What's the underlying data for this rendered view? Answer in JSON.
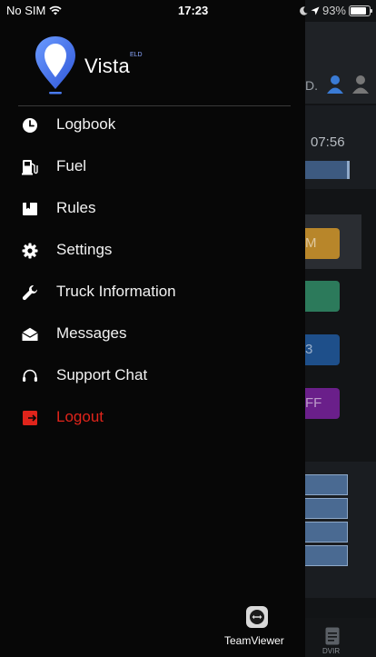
{
  "status_bar": {
    "carrier": "No SIM",
    "time": "17:23",
    "battery": "93%",
    "battery_level": 0.93
  },
  "drawer": {
    "brand": {
      "name": "Vista",
      "sup": "ELD"
    },
    "menu": [
      {
        "label": "Logbook",
        "icon": "clock-icon"
      },
      {
        "label": "Fuel",
        "icon": "fuel-pump-icon"
      },
      {
        "label": "Rules",
        "icon": "book-icon"
      },
      {
        "label": "Settings",
        "icon": "gear-icon"
      },
      {
        "label": "Truck Information",
        "icon": "wrench-icon"
      },
      {
        "label": "Messages",
        "icon": "envelope-icon"
      },
      {
        "label": "Support Chat",
        "icon": "headset-icon"
      },
      {
        "label": "Logout",
        "icon": "logout-icon"
      }
    ],
    "teamviewer": {
      "label": "TeamViewer"
    }
  },
  "background": {
    "driver_initial": "D.",
    "time": "07:56",
    "status_chips": [
      {
        "text": "M",
        "color": "#b8862a"
      },
      {
        "text": "",
        "color": "#2c7a5b"
      },
      {
        "text": "3",
        "color": "#1e4f8a"
      },
      {
        "text": "FF",
        "color": "#6a1f8a"
      }
    ],
    "tab_label": "DVIR"
  },
  "colors": {
    "drawer_bg": "#070707",
    "logout": "#e0241b",
    "brand_gradient_top": "#3f6ff0",
    "brand_gradient_bottom": "#6ea8ff"
  }
}
